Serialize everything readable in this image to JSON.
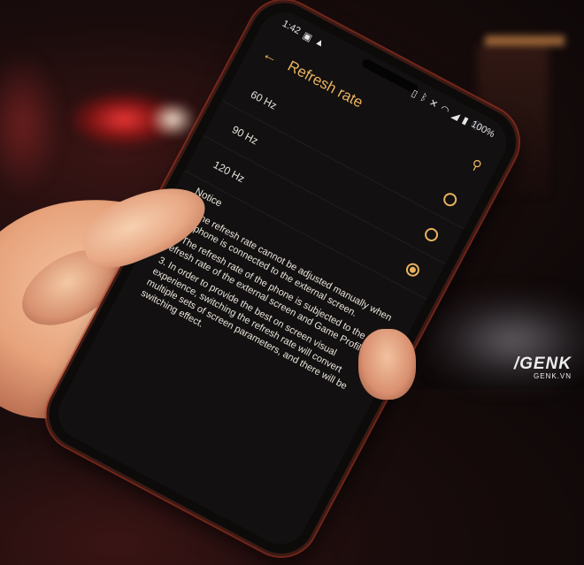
{
  "status_bar": {
    "time": "1:42",
    "battery": "100%",
    "left_icons": [
      "gallery-icon",
      "warning-icon"
    ],
    "right_icons": [
      "vibrate-icon",
      "bluetooth-icon",
      "mute-icon",
      "wifi-icon",
      "signal-icon",
      "battery-icon"
    ]
  },
  "app_bar": {
    "title": "Refresh rate",
    "back_icon": "←",
    "search_icon": "⚲"
  },
  "options": [
    {
      "label": "60 Hz",
      "selected": false
    },
    {
      "label": "90 Hz",
      "selected": false
    },
    {
      "label": "120 Hz",
      "selected": true
    }
  ],
  "notice": {
    "title": "Notice",
    "items": [
      "1. The refresh rate cannot be adjusted manually when the phone is connected to the external screen.",
      "2. The refresh rate of the phone is subjected to the refresh rate of the external screen and Game Profiles.",
      "3. In order to provide the best on screen visual experience, switching the refresh rate will convert multiple sets of screen parameters, and there will be switching effect."
    ]
  },
  "watermark": {
    "logo": "/GENK",
    "site": "GENK.VN"
  },
  "colors": {
    "accent": "#e9b25e",
    "screen_bg": "#121010"
  }
}
